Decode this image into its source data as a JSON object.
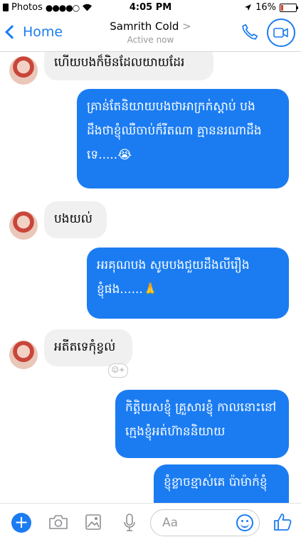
{
  "status_bar": {
    "app": "Photos",
    "signal": "●●●●○",
    "time": "4:05 PM",
    "battery": "16%",
    "battery_level": 0.16
  },
  "header": {
    "back_label": "Home",
    "contact_name": "Samrith Cold",
    "contact_arrow": ">",
    "status": "Active now",
    "phone_icon": "phone-icon",
    "video_icon": "video-call-icon"
  },
  "messages": [
    {
      "from": "them",
      "text": "ហើយបងក៏មិនដែលយាយដែរ"
    },
    {
      "from": "me",
      "text": "គ្រាន់តែនិយាយបងថាអាក្រក់ស្តាប់ បងដឹងថាខ្ញុំឈឺចាប់ក៏រីតណា គ្មាននរណាដឹងទេ.....😭"
    },
    {
      "from": "them",
      "text": "បងយល់"
    },
    {
      "from": "me",
      "text": "អរគុណបង សូមបងជួយដឹងលីរឿងខ្ញុំផង......🙏"
    },
    {
      "from": "them",
      "text": "អតីតទេកុំខ្វល់"
    },
    {
      "from": "me",
      "text": "កិត្តិយសខ្ញុំ គ្រួសារខ្ញុំ កាលនោះនៅក្មេងខ្ញុំអត់ហ៊ាននិយាយ"
    },
    {
      "from": "me",
      "text": "ខ្ញុំខ្លាចខ្មាស់គេ ប៉ាម៉ាក់ខ្ញុំ"
    }
  ],
  "reaction_add": "☺+",
  "composer": {
    "placeholder": "Aa",
    "emoji_icon": "smiley-icon",
    "like_icon": "thumbs-up-icon"
  },
  "colors": {
    "accent": "#1b7cf2",
    "incoming_bubble": "#f1f0f0",
    "battery_low": "#e23b2e"
  }
}
